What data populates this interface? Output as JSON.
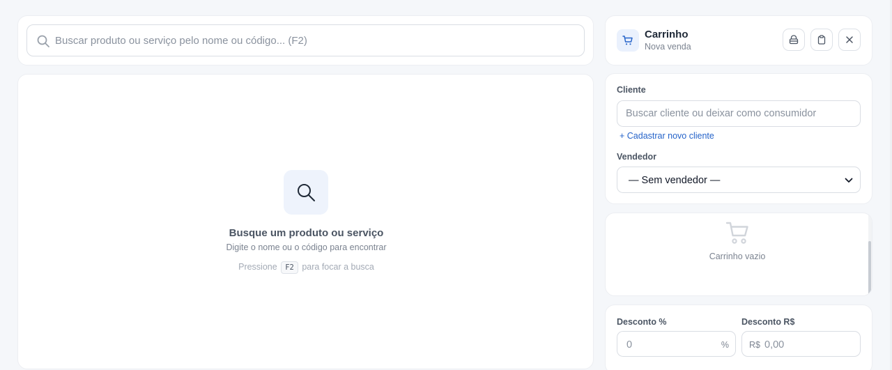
{
  "search": {
    "placeholder": "Buscar produto ou serviço pelo nome ou código... (F2)"
  },
  "empty_state": {
    "icon": "search-icon",
    "title": "Busque um produto ou serviço",
    "subtitle": "Digite o nome ou o código para encontrar",
    "hint_prefix": "Pressione",
    "hint_key": "F2",
    "hint_suffix": "para focar a busca"
  },
  "cart_header": {
    "icon": "cart-icon",
    "title": "Carrinho",
    "subtitle": "Nova venda",
    "buttons": [
      "hold-icon",
      "clipboard-icon",
      "close-icon"
    ]
  },
  "client": {
    "label": "Cliente",
    "placeholder": "Buscar cliente ou deixar como consumidor",
    "new_client_link": "+ Cadastrar novo cliente"
  },
  "seller": {
    "label": "Vendedor",
    "selected": "— Sem vendedor —"
  },
  "cart_items": {
    "empty_text": "Carrinho vazio"
  },
  "discount": {
    "percent_label": "Desconto %",
    "percent_placeholder": "0",
    "percent_unit": "%",
    "value_label": "Desconto R$",
    "value_prefix": "R$",
    "value_placeholder": "0,00"
  },
  "colors": {
    "accent": "#2563c9",
    "background": "#f5f7fa",
    "card": "#ffffff"
  }
}
